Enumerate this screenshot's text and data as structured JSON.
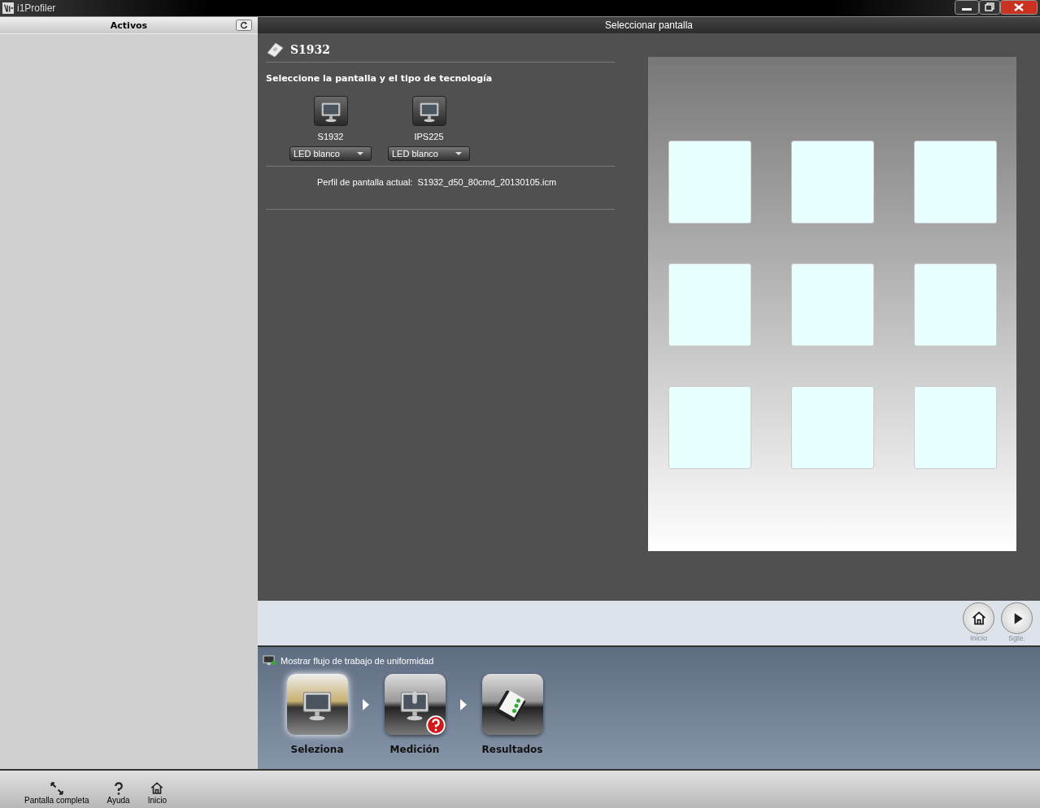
{
  "window": {
    "title": "i1Profiler"
  },
  "sidebar": {
    "title": "Activos"
  },
  "header": {
    "title": "Seleccionar pantalla"
  },
  "display": {
    "name": "S1932",
    "instruction": "Seleccione la pantalla y el tipo de tecnología",
    "monitors": [
      {
        "name": "S1932",
        "technology": "LED blanco"
      },
      {
        "name": "IPS225",
        "technology": "LED blanco"
      }
    ],
    "profile_label": "Perfil de pantalla actual:",
    "profile_value": "S1932_d50_80cmd_20130105.icm"
  },
  "nav_buttons": [
    {
      "kind": "home",
      "label": "Inicio"
    },
    {
      "kind": "next",
      "label": "Sgte."
    }
  ],
  "workflow": {
    "title": "Mostrar flujo de trabajo de uniformidad",
    "steps": [
      {
        "kind": "select",
        "label": "Seleziona",
        "selected": true,
        "alert": false
      },
      {
        "kind": "measure",
        "label": "Medición",
        "selected": false,
        "alert": true
      },
      {
        "kind": "results",
        "label": "Resultados",
        "selected": false,
        "alert": false
      }
    ]
  },
  "bottom_bar": [
    {
      "kind": "fullscreen",
      "label": "Pantalla completa"
    },
    {
      "kind": "help",
      "label": "Ayuda"
    },
    {
      "kind": "home",
      "label": "Inicio"
    }
  ]
}
